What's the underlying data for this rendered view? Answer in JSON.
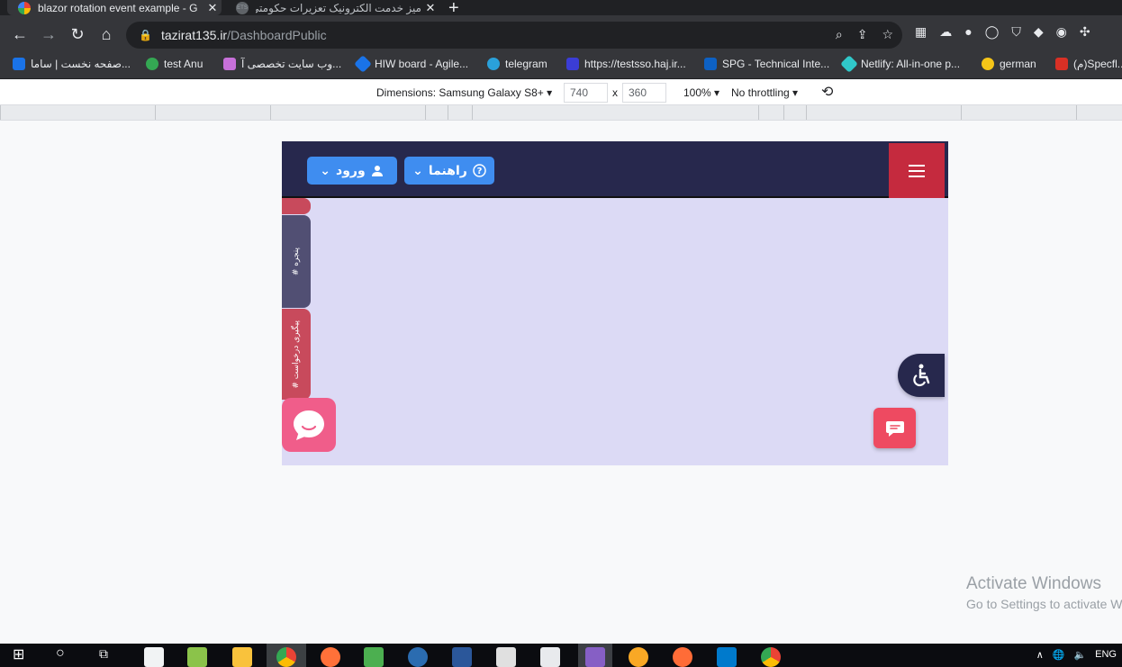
{
  "tabs": [
    {
      "title": "blazor rotation event example - G",
      "close": "✕"
    },
    {
      "title": "میز خدمت الکترونیک تعزیرات حکومتی",
      "favicon": "ETS",
      "close": "✕"
    }
  ],
  "new_tab": "+",
  "address": {
    "host": "tazirat135.ir",
    "path": "/DashboardPublic"
  },
  "bookmarks": [
    {
      "label": "صفحه نخست | ساما...",
      "color": "#1a73e8"
    },
    {
      "label": "test Anu",
      "color": "#34a853"
    },
    {
      "label": "وب سایت تخصصی آ...",
      "color": "#c770d9"
    },
    {
      "label": "HIW board - Agile...",
      "color": "#1a73e8"
    },
    {
      "label": "telegram",
      "color": "#2aa1da"
    },
    {
      "label": "https://testsso.haj.ir...",
      "color": "#3b3dd6"
    },
    {
      "label": "SPG - Technical Inte...",
      "color": "#0d61c4"
    },
    {
      "label": "Netlify: All-in-one p...",
      "color": "#30c8c9"
    },
    {
      "label": "german",
      "color": "#f5c518"
    },
    {
      "label": "(م)Specfl...",
      "color": "#d93025"
    }
  ],
  "devtools": {
    "dimensions": "Dimensions: Samsung Galaxy S8+",
    "width": "740",
    "times": "x",
    "height": "360",
    "zoom": "100%",
    "throttle": "No throttling"
  },
  "app": {
    "login_label": "ورود",
    "help_label": "راهنما",
    "side_tabs": [
      "# پنجره",
      "# پیگیری درخواست"
    ]
  },
  "watermark": {
    "line1": "Activate Windows",
    "line2": "Go to Settings to activate Windows."
  },
  "tray": {
    "lang": "ENG"
  },
  "colors": {
    "appbar": "#27284d",
    "page_bg": "#dcdaf5",
    "menu_red": "#c52a3e",
    "pill_blue": "#3f8df0",
    "chat_pink": "#f05d8a",
    "msg_red": "#ee4a61"
  }
}
